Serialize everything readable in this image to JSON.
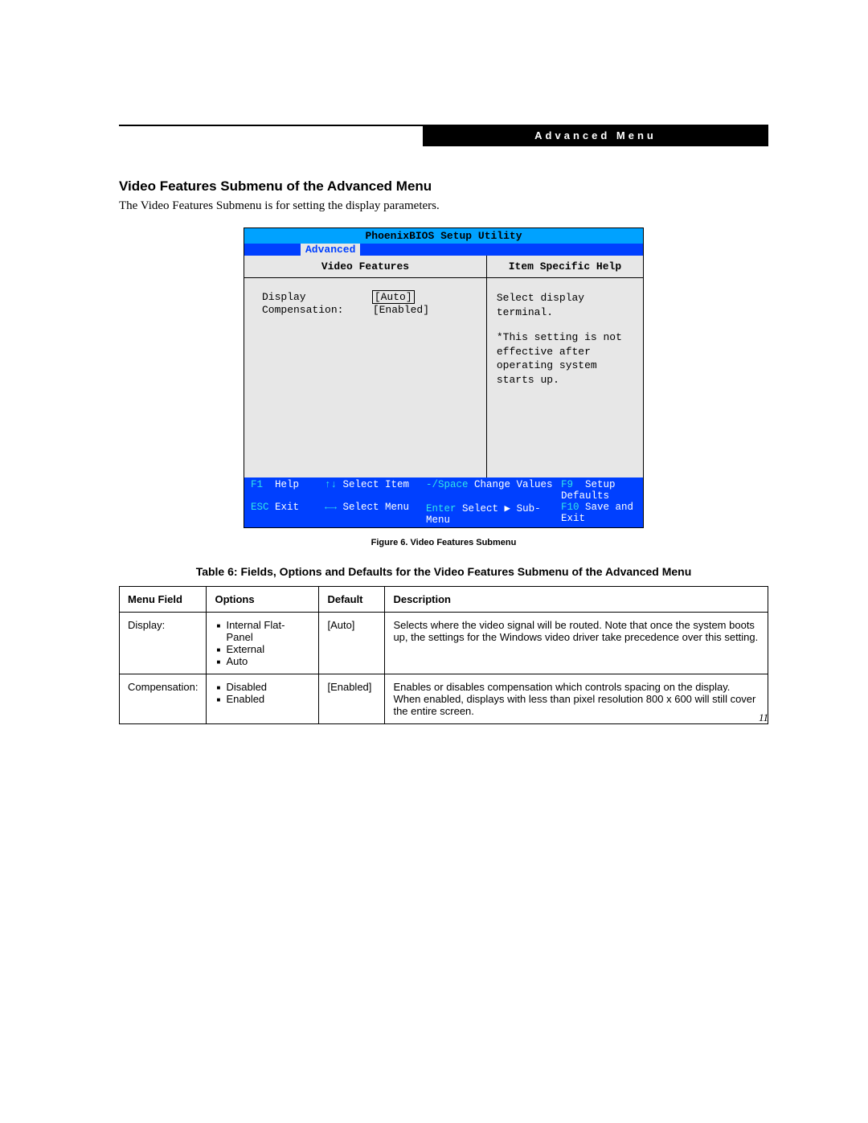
{
  "badge": "Advanced Menu",
  "section_title": "Video Features Submenu of the Advanced Menu",
  "intro": "The Video Features Submenu is for setting the display parameters.",
  "bios": {
    "title": "PhoenixBIOS Setup Utility",
    "active_tab": "Advanced",
    "left_header": "Video Features",
    "right_header": "Item Specific Help",
    "fields": {
      "display_label": "Display",
      "display_value": "[Auto]",
      "comp_label": "Compensation:",
      "comp_value": "[Enabled]"
    },
    "help": {
      "line1": "Select display terminal.",
      "line2": "*This setting is not effective after operating system starts up."
    },
    "footer": {
      "f1": "F1",
      "help": "Help",
      "updn": "↑↓",
      "select_item": "Select Item",
      "minspace": "-/Space",
      "change_values": "Change Values",
      "f9": "F9",
      "setup_defaults": "Setup Defaults",
      "esc": "ESC",
      "exit": "Exit",
      "lr": "←→",
      "select_menu": "Select Menu",
      "enter": "Enter",
      "select_sub": "Select ▶ Sub-Menu",
      "f10": "F10",
      "save_exit": "Save and Exit"
    }
  },
  "figure_caption": "Figure 6.   Video Features Submenu",
  "table_caption": "Table 6: Fields, Options and Defaults for the Video Features Submenu of the Advanced Menu",
  "table": {
    "headers": {
      "menu_field": "Menu Field",
      "options": "Options",
      "default": "Default",
      "description": "Description"
    },
    "rows": [
      {
        "menu_field": "Display:",
        "options": [
          "Internal Flat-Panel",
          "External",
          "Auto"
        ],
        "default": "[Auto]",
        "description": "Selects where the video signal will be routed. Note that once the system boots up, the settings for the Windows video driver take precedence over this setting."
      },
      {
        "menu_field": "Compensation:",
        "options": [
          "Disabled",
          "Enabled"
        ],
        "default": "[Enabled]",
        "description": "Enables or disables compensation which controls spacing on the dis­play. When enabled, displays with less than pixel resolution 800 x 600 will still cover the entire screen."
      }
    ]
  },
  "page_number": "11"
}
